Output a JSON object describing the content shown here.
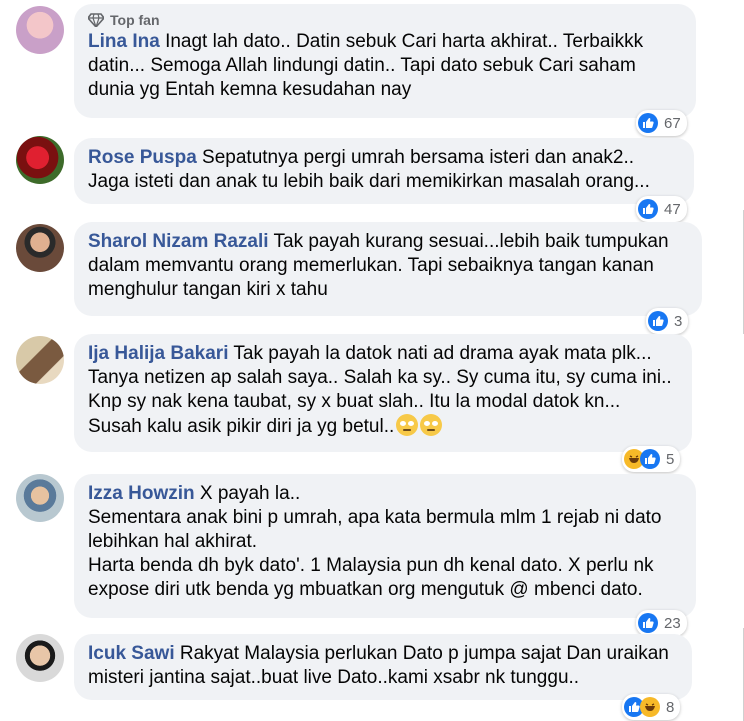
{
  "comments": [
    {
      "badge": "Top fan",
      "author": "Lina Ina",
      "text": " Inagt lah dato.. Datin sebuk Cari harta akhirat.. Terbaikkk datin... Semoga Allah lindungi datin.. Tapi dato sebuk Cari saham dunia yg Entah kemna kesudahan nay",
      "reactions": [
        "like"
      ],
      "count": "67"
    },
    {
      "author": "Rose Puspa",
      "text": " Sepatutnya pergi umrah bersama isteri dan anak2.. Jaga isteti dan anak tu lebih baik dari memikirkan masalah orang...",
      "reactions": [
        "like"
      ],
      "count": "47"
    },
    {
      "author": "Sharol Nizam Razali",
      "text": " Tak payah kurang sesuai...lebih baik tumpukan dalam memvantu orang memerlukan. Tapi sebaiknya tangan kanan menghulur tangan kiri x tahu",
      "reactions": [
        "like"
      ],
      "count": "3"
    },
    {
      "author": "Ija Halija Bakari",
      "text": " Tak payah la datok nati ad drama ayak mata plk... Tanya netizen ap salah saya.. Salah ka sy.. Sy cuma itu, sy cuma ini.. Knp sy nak kena taubat, sy x buat slah.. Itu la modal datok kn... Susah kalu asik pikir diri ja yg betul..",
      "emoji_icons": [
        "rolling-eyes-emoji",
        "rolling-eyes-emoji"
      ],
      "reactions": [
        "haha",
        "like"
      ],
      "count": "5"
    },
    {
      "author": "Izza Howzin",
      "text": " X payah la..\nSementara anak bini p umrah, apa kata bermula mlm 1 rejab ni dato lebihkan hal akhirat.\nHarta benda dh byk dato'. 1 Malaysia pun dh kenal dato. X perlu nk expose diri utk benda yg mbuatkan org mengutuk @ mbenci dato.",
      "reactions": [
        "like"
      ],
      "count": "23"
    },
    {
      "author": "Icuk Sawi",
      "text": " Rakyat Malaysia perlukan Dato p jumpa sajat Dan uraikan misteri jantina sajat..buat live Dato..kami xsabr nk tunggu..",
      "reactions": [
        "like",
        "haha"
      ],
      "count": "8"
    }
  ],
  "colors": {
    "author": "#385898",
    "bubble": "#f0f2f5",
    "like": "#1877f2",
    "haha": "#f7b928"
  }
}
